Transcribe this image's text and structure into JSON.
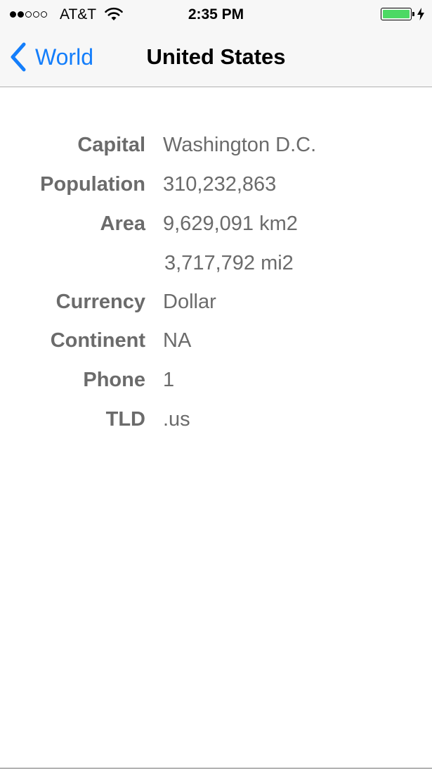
{
  "status_bar": {
    "carrier": "AT&T",
    "time": "2:35 PM",
    "signal_bars_filled": 2,
    "signal_bars_total": 5,
    "battery_level": 1.0,
    "battery_color": "#4cd964",
    "charging": true
  },
  "nav": {
    "back_label": "World",
    "title": "United States",
    "tint_color": "#147efb"
  },
  "details": {
    "capital": {
      "label": "Capital",
      "value": "Washington D.C."
    },
    "population": {
      "label": "Population",
      "value": "310,232,863"
    },
    "area": {
      "label": "Area",
      "value_km": "9,629,091 km2",
      "value_mi": "3,717,792 mi2"
    },
    "currency": {
      "label": "Currency",
      "value": "Dollar"
    },
    "continent": {
      "label": "Continent",
      "value": "NA"
    },
    "phone": {
      "label": "Phone",
      "value": "1"
    },
    "tld": {
      "label": "TLD",
      "value": ".us"
    }
  }
}
